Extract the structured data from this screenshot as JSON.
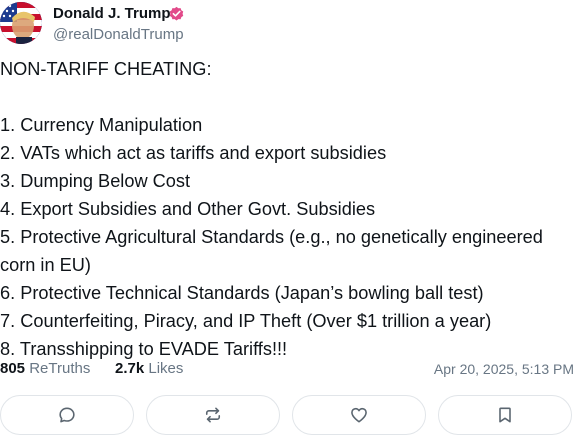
{
  "author": {
    "display_name": "Donald J. Trump",
    "handle": "@realDonaldTrump",
    "verified": true,
    "avatar_icon": "flag-portrait-avatar",
    "verified_color": "#e24a8a"
  },
  "post": {
    "intro": "NON-TARIFF CHEATING:",
    "items": [
      "1. Currency Manipulation",
      "2. VATs which act as tariffs and export subsidies",
      "3. Dumping Below Cost",
      "4. Export Subsidies and Other Govt. Subsidies",
      "5. Protective Agricultural Standards (e.g., no genetically engineered corn in EU)",
      "6. Protective Technical Standards (Japan’s bowling ball test)",
      "7. Counterfeiting, Piracy, and IP Theft (Over $1 trillion a year)",
      "8. Transshipping to EVADE Tariffs!!!"
    ]
  },
  "stats": {
    "retruths_count": "805",
    "retruths_label": "ReTruths",
    "likes_count": "2.7k",
    "likes_label": "Likes",
    "timestamp": "Apr 20, 2025, 5:13 PM"
  },
  "actions": [
    {
      "icon": "reply-icon"
    },
    {
      "icon": "retruth-icon"
    },
    {
      "icon": "like-icon"
    },
    {
      "icon": "bookmark-icon"
    }
  ],
  "colors": {
    "text": "#0f1419",
    "muted": "#687684",
    "border": "#e1e5e9",
    "icon": "#5b6670"
  }
}
